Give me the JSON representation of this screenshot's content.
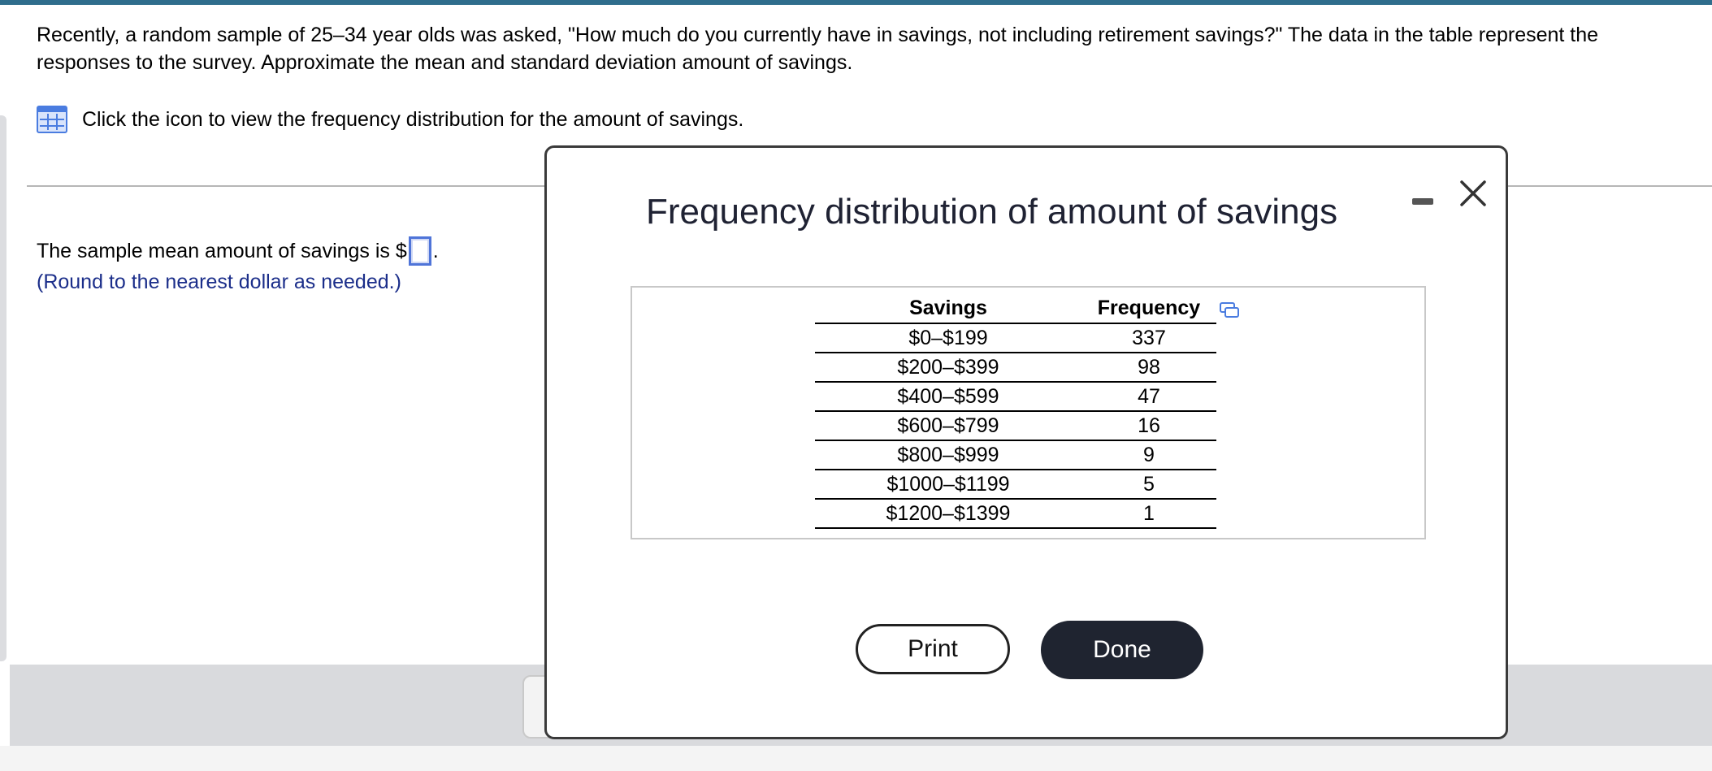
{
  "question": {
    "text": "Recently, a random sample of 25–34 year olds was asked, \"How much do you currently have in savings, not including retirement savings?\" The data in the table represent the responses to the survey. Approximate the mean and standard deviation amount of savings."
  },
  "icon_link": {
    "icon": "table-grid-icon",
    "text": "Click the icon to view the frequency distribution for the amount of savings."
  },
  "answer": {
    "prefix": "The sample mean amount of savings is $",
    "value": "",
    "suffix": ".",
    "hint": "(Round to the nearest dollar as needed.)"
  },
  "modal": {
    "title": "Frequency distribution of amount of savings",
    "minimize_icon": "minimize-icon",
    "close_icon": "close-x-icon",
    "copy_icon": "copy-table-icon",
    "table": {
      "headers": [
        "Savings",
        "Frequency"
      ],
      "rows": [
        [
          "$0–$199",
          "337"
        ],
        [
          "$200–$399",
          "98"
        ],
        [
          "$400–$599",
          "47"
        ],
        [
          "$600–$799",
          "16"
        ],
        [
          "$800–$999",
          "9"
        ],
        [
          "$1000–$1199",
          "5"
        ],
        [
          "$1200–$1399",
          "1"
        ]
      ]
    },
    "print_label": "Print",
    "done_label": "Done"
  },
  "colors": {
    "topbar": "#2f6d8c",
    "link_blue": "#4a7ce0",
    "hint_text": "#1b2e8a",
    "done_button": "#1f2430"
  }
}
